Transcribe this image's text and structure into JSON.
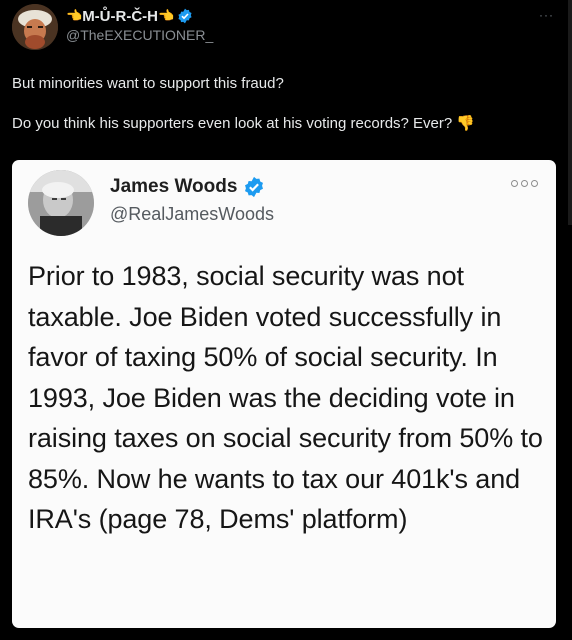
{
  "post": {
    "display_name_left_emoji": "👈",
    "display_name": "M-Ů-R-Č-H",
    "display_name_right_emoji": "👈",
    "handle": "@TheEXECUTIONER_",
    "more_label": "···",
    "text_line_1": "But minorities want to support this fraud?",
    "text_line_2": "Do you think his supporters even look at his voting records? Ever?",
    "text_emoji": "👎"
  },
  "quoted_card": {
    "display_name": "James Woods",
    "handle": "@RealJamesWoods",
    "body": "Prior to 1983, social security was not taxable. Joe Biden voted successfully in favor of taxing 50% of social security. In 1993, Joe Biden was the deciding vote in raising taxes on social security from 50% to 85%. Now he wants to tax our 401k's and IRA's (page 78, Dems' platform)"
  },
  "colors": {
    "background": "#000000",
    "text_primary": "#e7e9ea",
    "text_secondary": "#8a8f94",
    "verified_blue": "#1d9bf0",
    "card_background": "#fbfbfb"
  }
}
